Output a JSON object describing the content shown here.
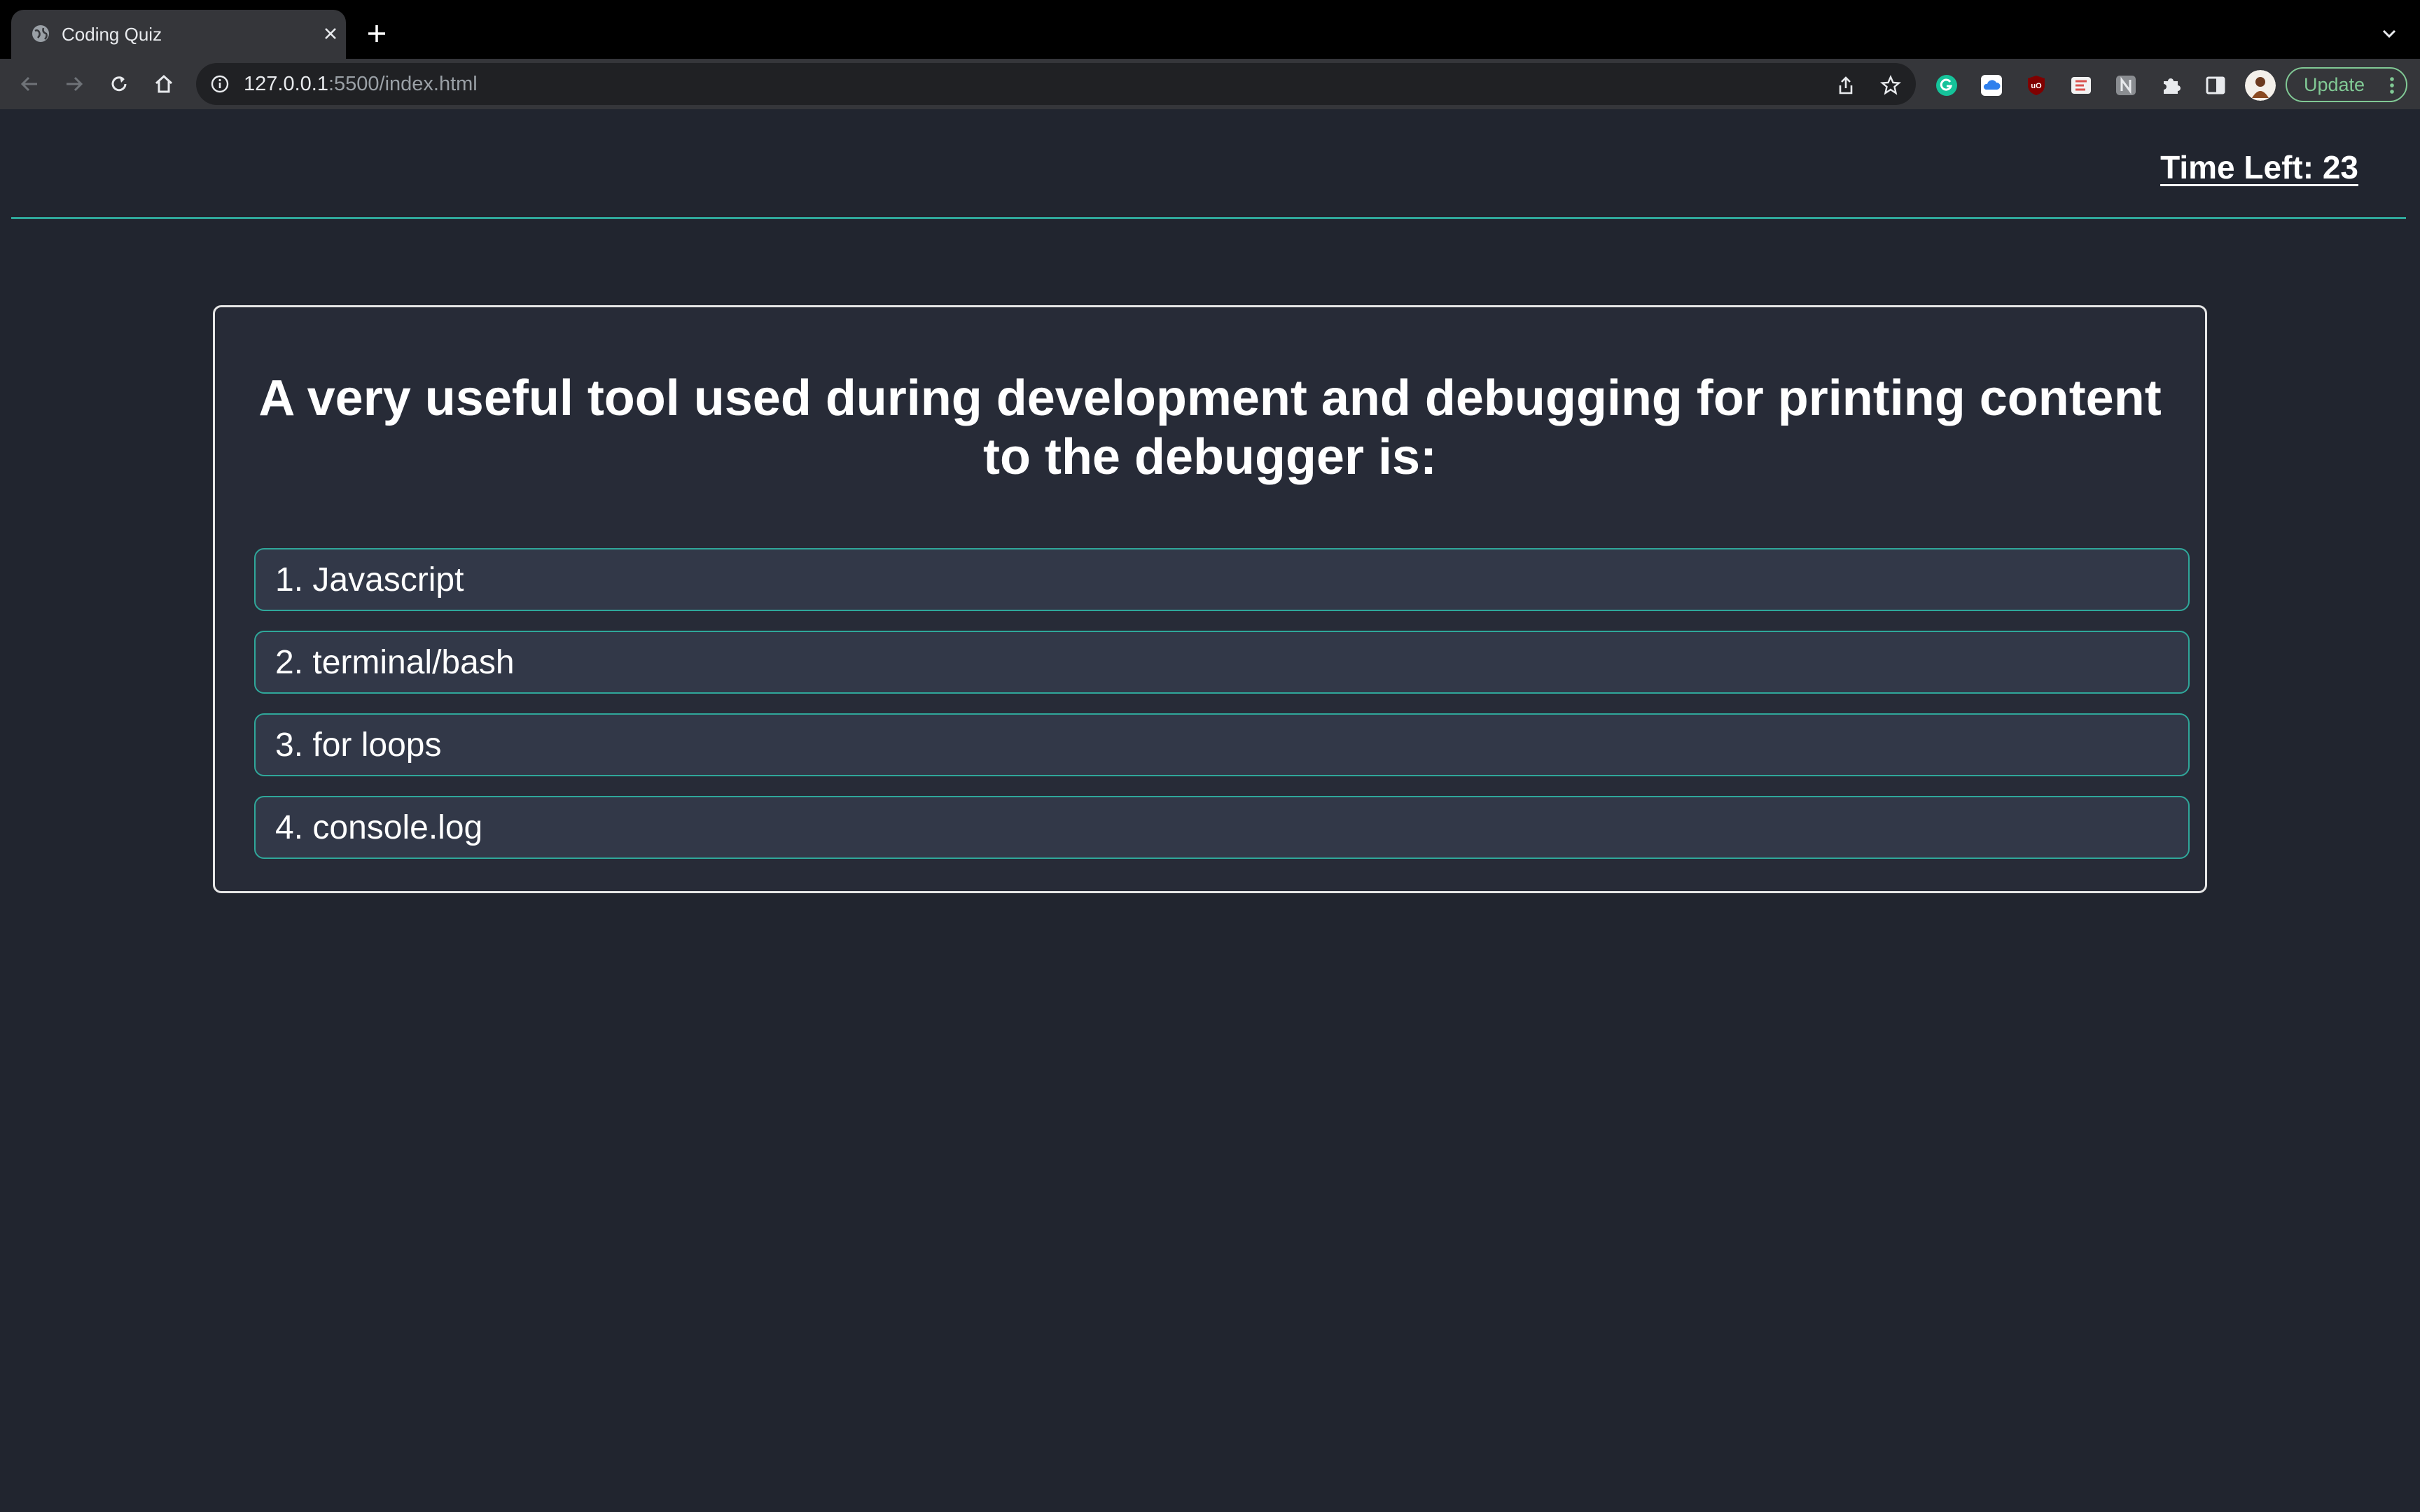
{
  "browser": {
    "tab": {
      "title": "Coding Quiz"
    },
    "url": {
      "host": "127.0.0.1",
      "path": ":5500/index.html"
    },
    "extensions": [
      {
        "name": "grammarly",
        "glyph": "G",
        "color": "#15c39a"
      },
      {
        "name": "cloud",
        "glyph": "☁",
        "color": "#2f80ed"
      },
      {
        "name": "ublock",
        "glyph": "uO",
        "color": "#800000"
      },
      {
        "name": "reader",
        "glyph": "Ⓡ",
        "color": "#d9534f"
      },
      {
        "name": "notion",
        "glyph": "N",
        "color": "#808080"
      }
    ],
    "update_label": "Update"
  },
  "quiz": {
    "timer": "Time Left: 23",
    "question": "A very useful tool used during development and debugging for printing content to the debugger is:",
    "answers": [
      {
        "label": "1. Javascript"
      },
      {
        "label": "2. terminal/bash"
      },
      {
        "label": "3. for loops"
      },
      {
        "label": "4. console.log"
      }
    ]
  },
  "colors": {
    "page_bg": "#21252f",
    "card_bg": "#272b37",
    "answer_bg": "#323848",
    "accent": "#2fa79a",
    "text": "#ffffff"
  }
}
